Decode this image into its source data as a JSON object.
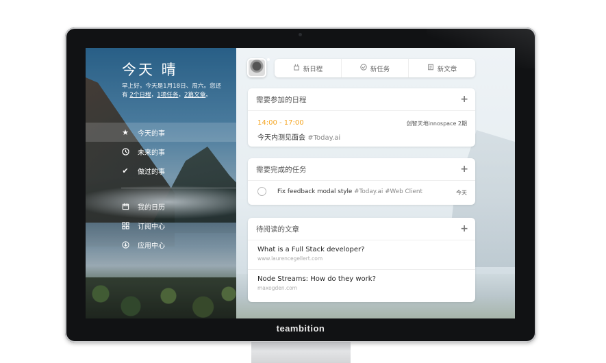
{
  "device": {
    "brand": "teambition"
  },
  "sidebar": {
    "title": "今天 晴",
    "greeting_prefix": "早上好，今天是1月18日、周六。您还有 ",
    "link_schedules": "2个日程",
    "sep1": "，",
    "link_tasks": "1项任务",
    "sep2": "，",
    "link_articles": "2篇文章",
    "greeting_suffix": "。",
    "nav_primary": [
      {
        "label": "今天的事",
        "icon": "star-icon"
      },
      {
        "label": "未来的事",
        "icon": "clock-icon"
      },
      {
        "label": "做过的事",
        "icon": "check-icon"
      }
    ],
    "nav_secondary": [
      {
        "label": "我的日历",
        "icon": "calendar-icon"
      },
      {
        "label": "订阅中心",
        "icon": "grid-icon"
      },
      {
        "label": "应用中心",
        "icon": "download-circle-icon"
      }
    ]
  },
  "toolbar": {
    "new_schedule": "新日程",
    "new_task": "新任务",
    "new_article": "新文章"
  },
  "schedules": {
    "title": "需要参加的日程",
    "add": "+",
    "item": {
      "time": "14:00 - 17:00",
      "location": "创智天地innospace 2期",
      "name": "今天内测见面会",
      "tag": "#Today.ai"
    }
  },
  "tasks": {
    "title": "需要完成的任务",
    "add": "+",
    "item": {
      "name": "Fix feedback modal style",
      "tag1": "#Today.ai",
      "tag2": "#Web Client",
      "due": "今天"
    }
  },
  "reads": {
    "title": "待阅读的文章",
    "add": "+",
    "items": [
      {
        "title": "What is a Full Stack developer?",
        "url": "www.laurencegellert.com"
      },
      {
        "title": "Node Streams: How do they work?",
        "url": "maxogden.com"
      }
    ]
  },
  "colors": {
    "accent_time": "#f5a623",
    "bezel": "#111214"
  }
}
